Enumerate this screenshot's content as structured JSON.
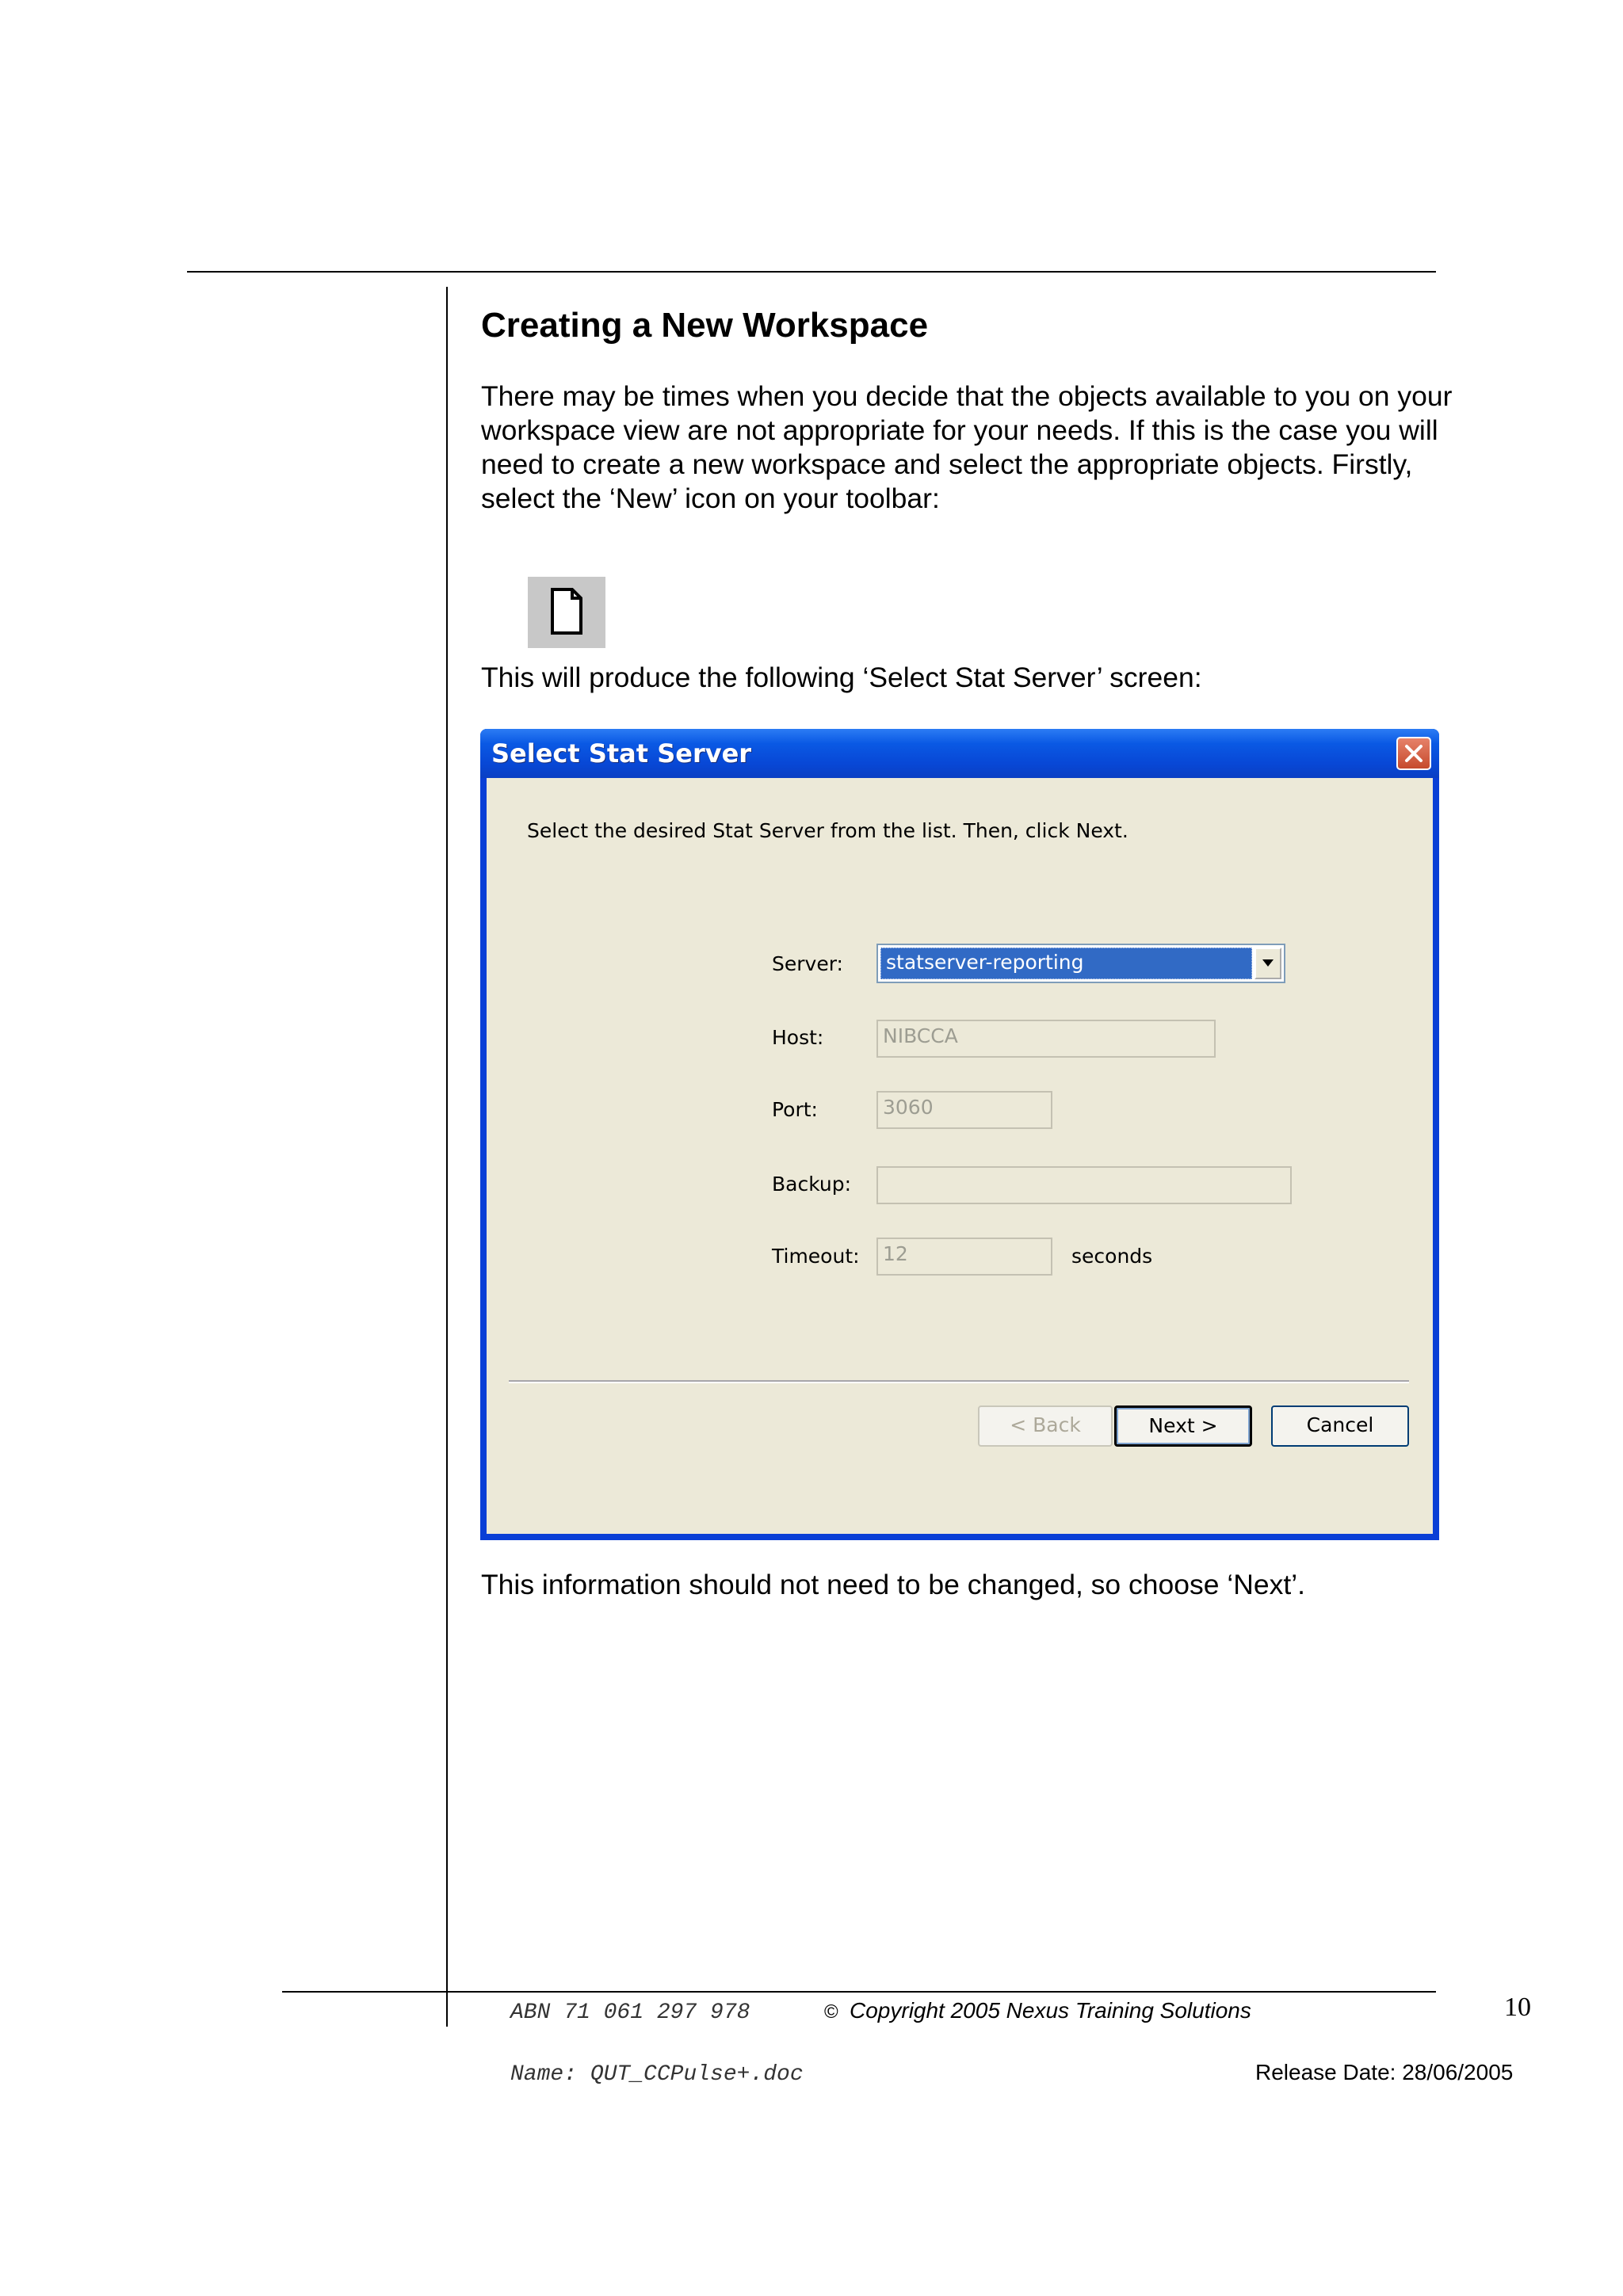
{
  "heading": "Creating a New Workspace",
  "intro_paragraph": "There may be times when you decide that the objects available to you on your workspace view are not appropriate for your needs.  If this is the case you will need to create a new workspace and select the appropriate objects.  Firstly, select the ‘New’ icon on your toolbar:",
  "toolbar_icon": "new-document-icon",
  "lead_in": "This will produce the following ‘Select Stat Server’ screen:",
  "dialog": {
    "title": "Select Stat Server",
    "instruction": "Select the desired Stat Server from the list. Then, click Next.",
    "fields": {
      "server_label": "Server:",
      "server_value": "statserver-reporting",
      "host_label": "Host:",
      "host_value": "NIBCCA",
      "port_label": "Port:",
      "port_value": "3060",
      "backup_label": "Backup:",
      "backup_value": "",
      "timeout_label": "Timeout:",
      "timeout_value": "12",
      "timeout_unit": "seconds"
    },
    "buttons": {
      "back": "< Back",
      "next": "Next >",
      "cancel": "Cancel"
    },
    "colors": {
      "titlebar": "#0a59e4",
      "client": "#ece9d8",
      "selection": "#316ac5"
    }
  },
  "closing_paragraph": "This information should not need to be changed, so choose ‘Next’.",
  "footer": {
    "abn": "ABN 71 061 297 978",
    "copyright_symbol": "©",
    "copyright": "Copyright 2005 Nexus Training Solutions",
    "page_number": "10",
    "document_name": "Name: QUT_CCPulse+.doc",
    "release_date": "Release Date: 28/06/2005"
  }
}
